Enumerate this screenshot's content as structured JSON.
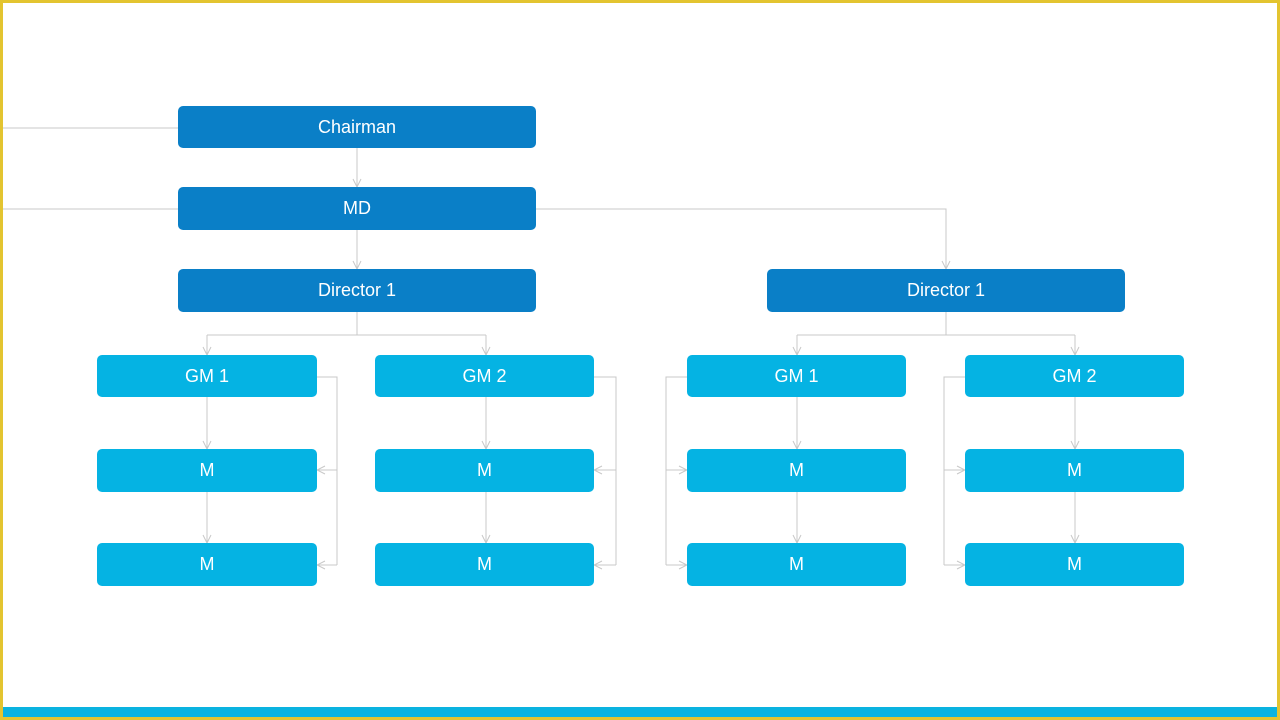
{
  "colors": {
    "dark_box": "#0a7fc7",
    "light_box": "#05b3e3",
    "border": "#e3c430",
    "bottom_bar": "#0bb3e0",
    "connector": "#c8c8c8"
  },
  "chairman": "Chairman",
  "md": "MD",
  "directors": [
    {
      "label": "Director 1",
      "gms": [
        {
          "label": "GM 1",
          "managers": [
            "M",
            "M"
          ]
        },
        {
          "label": "GM 2",
          "managers": [
            "M",
            "M"
          ]
        }
      ]
    },
    {
      "label": "Director 1",
      "gms": [
        {
          "label": "GM 1",
          "managers": [
            "M",
            "M"
          ]
        },
        {
          "label": "GM 2",
          "managers": [
            "M",
            "M"
          ]
        }
      ]
    }
  ]
}
